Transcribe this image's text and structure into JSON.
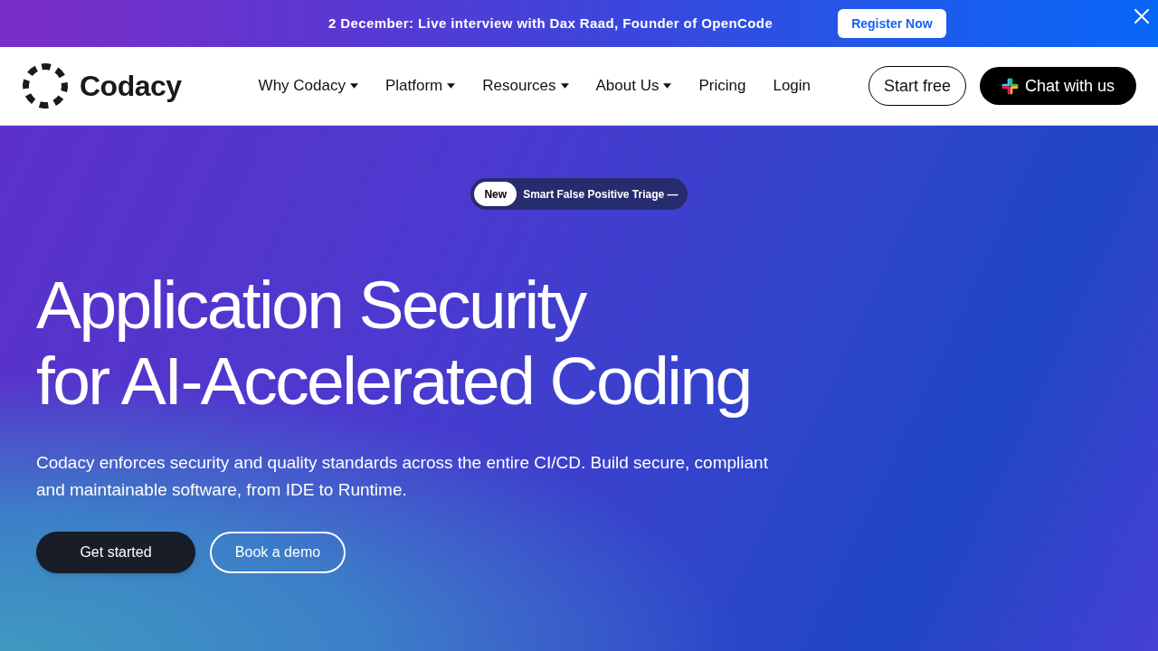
{
  "announcement": {
    "text": "2 December: Live interview with Dax Raad, Founder of OpenCode",
    "button": "Register Now"
  },
  "header": {
    "logo": "Codacy",
    "nav": [
      {
        "label": "Why Codacy",
        "has_menu": true
      },
      {
        "label": "Platform",
        "has_menu": true
      },
      {
        "label": "Resources",
        "has_menu": true
      },
      {
        "label": "About Us",
        "has_menu": true
      },
      {
        "label": "Pricing",
        "has_menu": false
      },
      {
        "label": "Login",
        "has_menu": false
      }
    ],
    "buttons": [
      {
        "label": "Start free",
        "kind": "outline"
      },
      {
        "label": "Chat with us",
        "kind": "chat"
      }
    ]
  },
  "hero": {
    "badge": {
      "tag": "New",
      "text": "Smart False Positive Triage —"
    },
    "title_lines": [
      "Application Security",
      "for AI-Accelerated Coding"
    ],
    "subtitle": "Codacy enforces security and quality standards across the entire CI/CD. Build secure, compliant and maintainable software, from IDE to Runtime.",
    "buttons": [
      {
        "label": "Get started",
        "kind": "primary"
      },
      {
        "label": "Book a demo",
        "kind": "outline"
      }
    ]
  }
}
